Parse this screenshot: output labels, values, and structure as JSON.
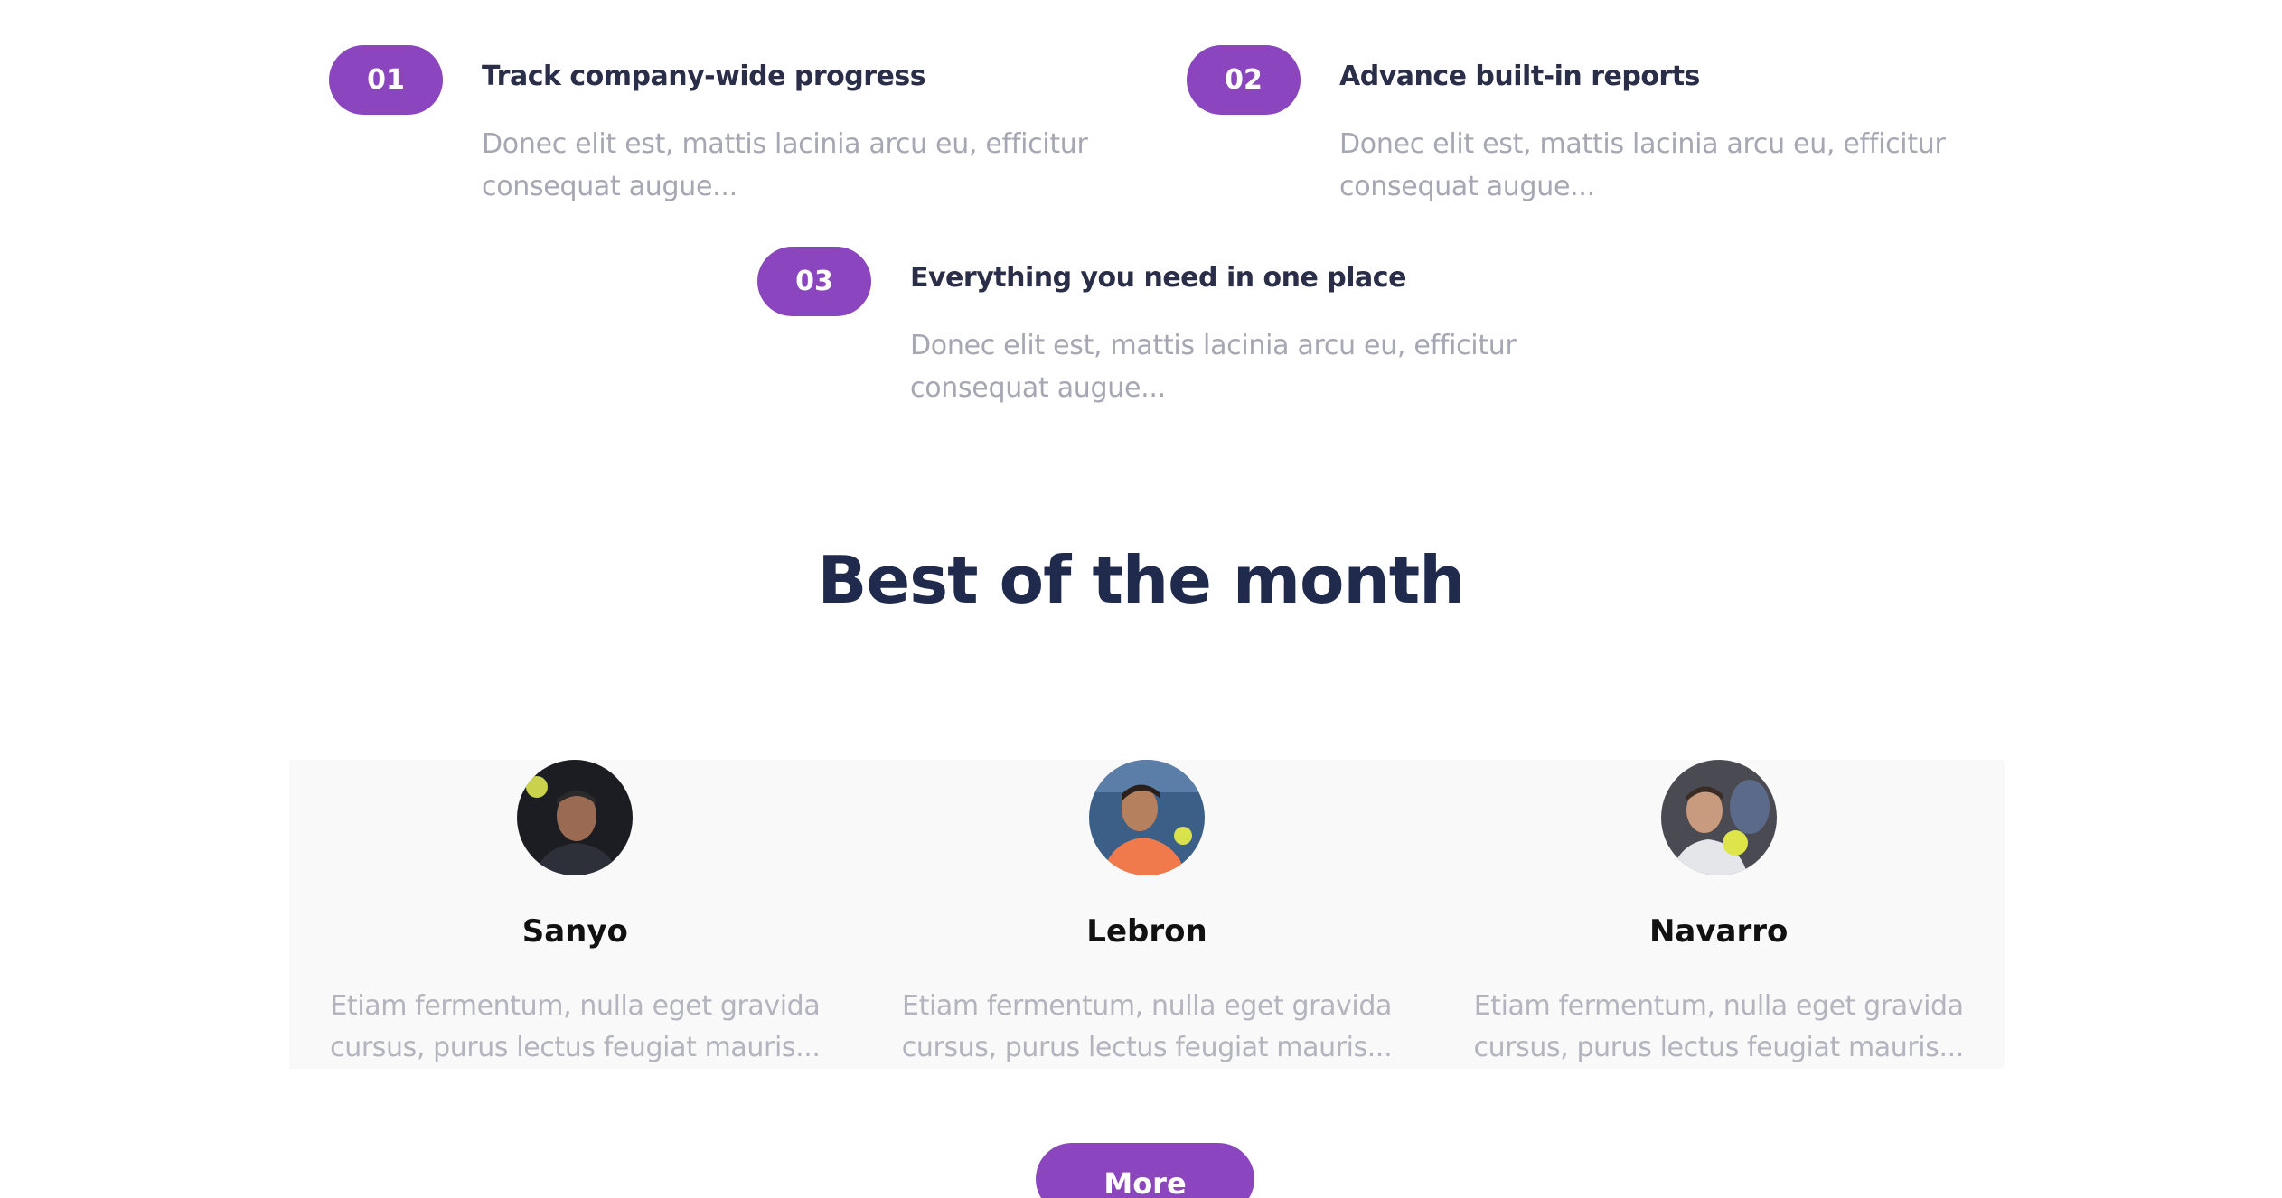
{
  "features": [
    {
      "number": "01",
      "title": "Track company-wide progress",
      "description": "Donec elit est, mattis lacinia arcu eu, efficitur consequat augue..."
    },
    {
      "number": "02",
      "title": "Advance built-in reports",
      "description": "Donec elit est, mattis lacinia arcu eu, efficitur consequat augue..."
    },
    {
      "number": "03",
      "title": "Everything you need in one place",
      "description": "Donec elit est, mattis lacinia arcu eu, efficitur consequat augue..."
    }
  ],
  "best_of_month": {
    "title": "Best of the month",
    "cards": [
      {
        "name": "Sanyo",
        "description": "Etiam fermentum, nulla eget gravida cursus, purus lectus feugiat mauris..."
      },
      {
        "name": "Lebron",
        "description": "Etiam fermentum, nulla eget gravida cursus, purus lectus feugiat mauris..."
      },
      {
        "name": "Navarro",
        "description": "Etiam fermentum, nulla eget gravida cursus, purus lectus feugiat mauris..."
      }
    ],
    "more_label": "More"
  },
  "colors": {
    "accent": "#8b46bf",
    "heading": "#1f2a4d",
    "muted": "#a6a7b2"
  }
}
